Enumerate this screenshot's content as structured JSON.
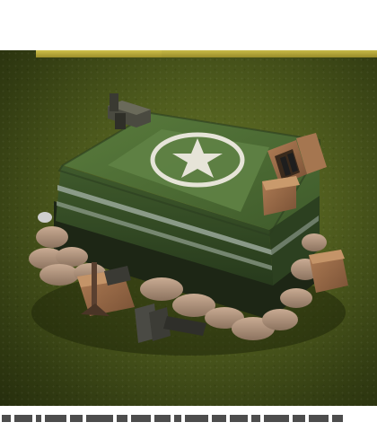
{
  "scene": {
    "subject": "",
    "colors": {
      "background_center": "#6b7a2a",
      "background_edge": "#262e0d",
      "tarp": "#4b6b33",
      "tarp_dark": "#33482a",
      "stripe": "#9aa89a",
      "emblem": "#e6e4d8",
      "sandbag": "#b79a84",
      "crate": "#9a6b4a",
      "gold_strip": "#cfc04a"
    },
    "icons": [
      "star-emblem-icon",
      "ammo-crate-icon",
      "sandbag-icon"
    ]
  }
}
